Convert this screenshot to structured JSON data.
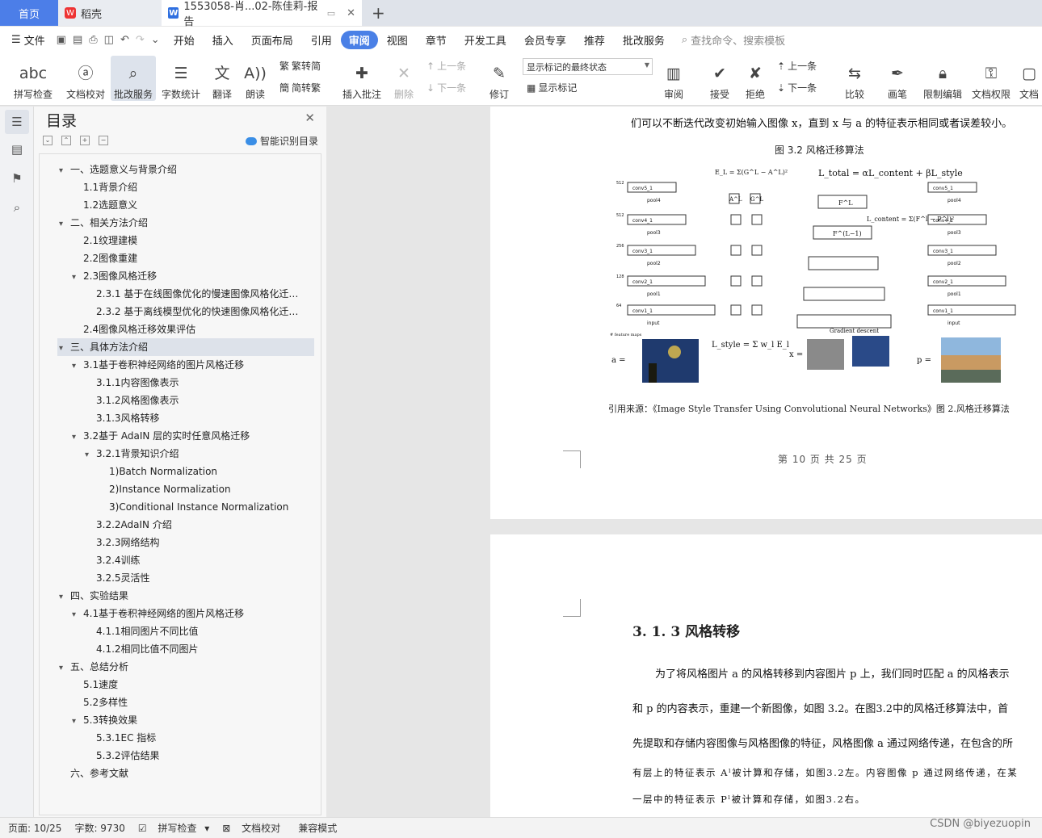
{
  "tabs": {
    "home": "首页",
    "daoke": "稻壳",
    "doc": "1553058-肖...02-陈佳莉-报告"
  },
  "menu": {
    "file": "文件",
    "items": [
      "开始",
      "插入",
      "页面布局",
      "引用",
      "审阅",
      "视图",
      "章节",
      "开发工具",
      "会员专享",
      "推荐",
      "批改服务"
    ],
    "active": "审阅",
    "search": "查找命令、搜索模板"
  },
  "ribbon": {
    "spell": "拼写检查",
    "check": "文档校对",
    "correct": "批改服务",
    "count": "字数统计",
    "translate": "翻译",
    "read": "朗读",
    "trad": "繁转简",
    "simp": "简转繁",
    "comment": "插入批注",
    "delete": "删除",
    "prev": "上一条",
    "next": "下一条",
    "dropdown": "显示标记的最终状态",
    "track": "修订",
    "showmark": "显示标记",
    "review": "审阅",
    "accept": "接受",
    "reject": "拒绝",
    "prev2": "上一条",
    "next2": "下一条",
    "compare": "比较",
    "pen": "画笔",
    "restrict": "限制编辑",
    "perm": "文档权限",
    "docx": "文档"
  },
  "toc": {
    "title": "目录",
    "smart": "智能识别目录",
    "items": [
      {
        "t": "一、选题意义与背景介绍",
        "lv": 0,
        "c": "v"
      },
      {
        "t": "1.1背景介绍",
        "lv": 1,
        "c": ""
      },
      {
        "t": "1.2选题意义",
        "lv": 1,
        "c": ""
      },
      {
        "t": "二、相关方法介绍",
        "lv": 0,
        "c": "v"
      },
      {
        "t": "2.1纹理建模",
        "lv": 1,
        "c": ""
      },
      {
        "t": "2.2图像重建",
        "lv": 1,
        "c": ""
      },
      {
        "t": "2.3图像风格迁移",
        "lv": 1,
        "c": "v"
      },
      {
        "t": "2.3.1 基于在线图像优化的慢速图像风格化迁移算法",
        "lv": 2,
        "c": ""
      },
      {
        "t": "2.3.2 基于离线模型优化的快速图像风格化迁移算法",
        "lv": 2,
        "c": ""
      },
      {
        "t": "2.4图像风格迁移效果评估",
        "lv": 1,
        "c": ""
      },
      {
        "t": "三、具体方法介绍",
        "lv": 0,
        "c": "v",
        "sel": true
      },
      {
        "t": "3.1基于卷积神经网络的图片风格迁移",
        "lv": 1,
        "c": "v"
      },
      {
        "t": "3.1.1内容图像表示",
        "lv": 2,
        "c": ""
      },
      {
        "t": "3.1.2风格图像表示",
        "lv": 2,
        "c": ""
      },
      {
        "t": "3.1.3风格转移",
        "lv": 2,
        "c": ""
      },
      {
        "t": "3.2基于 AdaIN 层的实时任意风格迁移",
        "lv": 1,
        "c": "v"
      },
      {
        "t": "3.2.1背景知识介绍",
        "lv": 2,
        "c": "v"
      },
      {
        "t": "1)Batch Normalization",
        "lv": 3,
        "c": ""
      },
      {
        "t": "2)Instance Normalization",
        "lv": 3,
        "c": ""
      },
      {
        "t": "3)Conditional Instance Normalization",
        "lv": 3,
        "c": ""
      },
      {
        "t": "3.2.2AdaIN 介绍",
        "lv": 2,
        "c": ""
      },
      {
        "t": "3.2.3网络结构",
        "lv": 2,
        "c": ""
      },
      {
        "t": "3.2.4训练",
        "lv": 2,
        "c": ""
      },
      {
        "t": "3.2.5灵活性",
        "lv": 2,
        "c": ""
      },
      {
        "t": "四、实验结果",
        "lv": 0,
        "c": "v"
      },
      {
        "t": "4.1基于卷积神经网络的图片风格迁移",
        "lv": 1,
        "c": "v"
      },
      {
        "t": "4.1.1相同图片不同比值",
        "lv": 2,
        "c": ""
      },
      {
        "t": "4.1.2相同比值不同图片",
        "lv": 2,
        "c": ""
      },
      {
        "t": "五、总结分析",
        "lv": 0,
        "c": "v"
      },
      {
        "t": "5.1速度",
        "lv": 1,
        "c": ""
      },
      {
        "t": "5.2多样性",
        "lv": 1,
        "c": ""
      },
      {
        "t": "5.3转换效果",
        "lv": 1,
        "c": "v"
      },
      {
        "t": "5.3.1EC 指标",
        "lv": 2,
        "c": ""
      },
      {
        "t": "5.3.2评估结果",
        "lv": 2,
        "c": ""
      },
      {
        "t": "六、参考文献",
        "lv": 0,
        "c": ""
      }
    ]
  },
  "doc": {
    "line1": "们可以不断迭代改变初始输入图像 x，直到 x 与 a 的特征表示相同或者误差较小。",
    "figcap": "图 3.2 风格迁移算法",
    "cite": "引用来源：《Image Style Transfer Using Convolutional Neural Networks》图 2.风格迁移算法",
    "pagenum": "第 10 页  共 25 页",
    "heading": "3. 1. 3 风格转移",
    "p1": "为了将风格图片 a 的风格转移到内容图片 p 上，我们同时匹配 a 的风格表示",
    "p2": "和 p 的内容表示，重建一个新图像，如图 3.2。在图3.2中的风格迁移算法中，首",
    "p3": "先提取和存储内容图像与风格图像的特征，风格图像 a 通过网络传递，在包含的所",
    "p4": "有层上的特征表示 Aˡ被计算和存储，如图3.2左。内容图像 p 通过网络传递，在某",
    "p5": "一层中的特征表示 Pˡ被计算和存储，如图3.2右。",
    "fig": {
      "conv_left": [
        "conv5_1",
        "conv4_1",
        "conv3_1",
        "conv2_1",
        "conv1_1"
      ],
      "pools": [
        "pool4",
        "pool3",
        "pool2",
        "pool1",
        "input"
      ],
      "maps": [
        "512",
        "512",
        "256",
        "128",
        "64"
      ],
      "mapslabel": "# feature maps",
      "EL": "E_L = Σ(G^L − A^L)²",
      "total": "L_total = αL_content + βL_style",
      "content": "L_content = Σ(F^l − P^l)²",
      "style": "L_style = Σ w_l E_l",
      "gd": "Gradient descent",
      "A": "a =",
      "X": "x =",
      "P": "p =",
      "FL": "F^L",
      "FL1": "F^(L−1)",
      "AL": "A^L",
      "GL": "G^L"
    }
  },
  "status": {
    "page": "页面: 10/25",
    "words": "字数: 9730",
    "spell": "拼写检查",
    "check": "文档校对",
    "compat": "兼容模式"
  },
  "watermark": "CSDN @biyezuopin"
}
